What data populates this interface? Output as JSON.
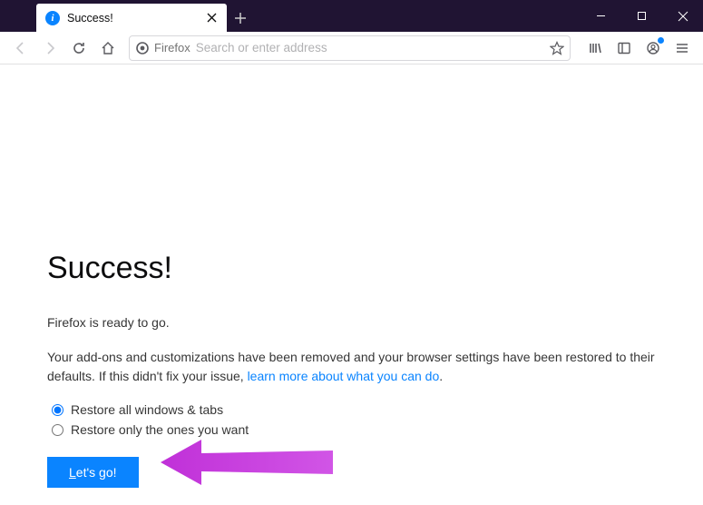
{
  "tab": {
    "title": "Success!"
  },
  "urlbar": {
    "identity_label": "Firefox",
    "placeholder": "Search or enter address"
  },
  "page": {
    "heading": "Success!",
    "subtitle": "Firefox is ready to go.",
    "body_prefix": "Your add-ons and customizations have been removed and your browser settings have been restored to their defaults. If this didn't fix your issue, ",
    "body_link": "learn more about what you can do",
    "body_suffix": ".",
    "radio1": "Restore all windows & tabs",
    "radio2": "Restore only the ones you want",
    "button_underline": "L",
    "button_rest": "et's go!"
  }
}
